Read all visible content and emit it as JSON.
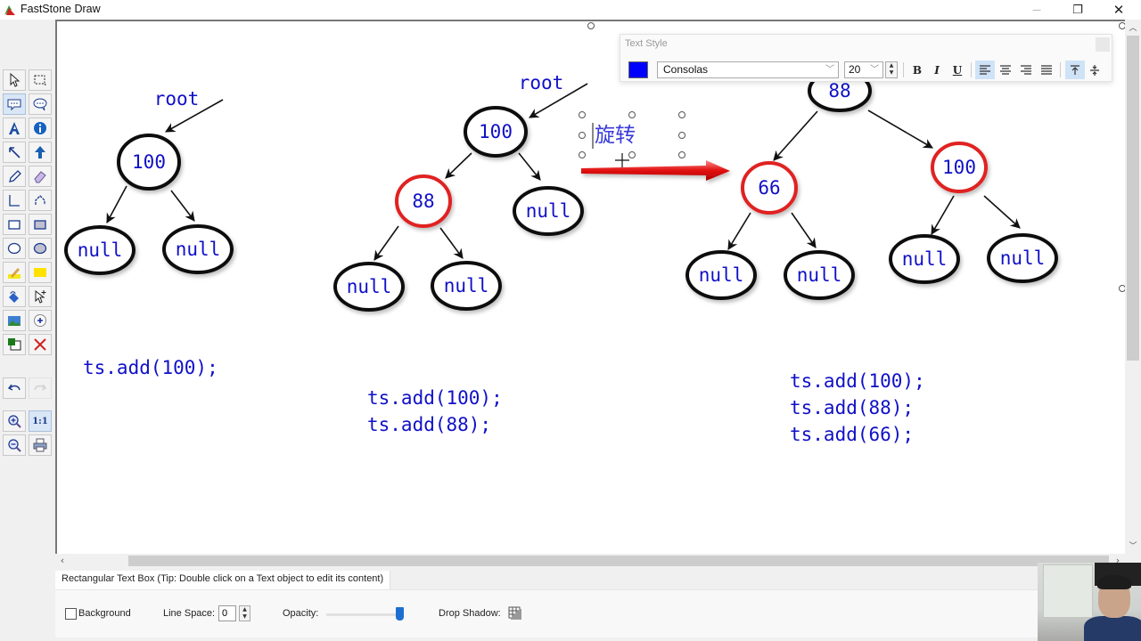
{
  "window": {
    "title": "FastStone Draw",
    "controls": {
      "minimize": "—",
      "maximize": "❐",
      "close": "✕"
    }
  },
  "toolbox": {
    "tools": [
      {
        "name": "select-tool",
        "icon": "cursor-arrow-icon"
      },
      {
        "name": "region-select-tool",
        "icon": "dashed-rect-icon"
      },
      {
        "name": "rect-callout-tool",
        "icon": "rect-callout-icon",
        "active": true
      },
      {
        "name": "round-callout-tool",
        "icon": "round-callout-icon"
      },
      {
        "name": "text-tool",
        "icon": "text-a-icon"
      },
      {
        "name": "info-tool",
        "icon": "info-icon"
      },
      {
        "name": "arrow-tool",
        "icon": "arrow-icon"
      },
      {
        "name": "thick-arrow-tool",
        "icon": "up-arrow-icon"
      },
      {
        "name": "pencil-tool",
        "icon": "pencil-icon"
      },
      {
        "name": "eraser-tool",
        "icon": "eraser-icon"
      },
      {
        "name": "line-tool",
        "icon": "polyline-icon"
      },
      {
        "name": "curve-tool",
        "icon": "curve-icon"
      },
      {
        "name": "rectangle-tool",
        "icon": "rectangle-icon"
      },
      {
        "name": "filled-rectangle-tool",
        "icon": "filled-rectangle-icon"
      },
      {
        "name": "ellipse-tool",
        "icon": "ellipse-icon"
      },
      {
        "name": "filled-ellipse-tool",
        "icon": "filled-ellipse-icon"
      },
      {
        "name": "highlighter-tool",
        "icon": "highlighter-icon"
      },
      {
        "name": "highlight-rect-tool",
        "icon": "yellow-rect-icon"
      },
      {
        "name": "fill-tool",
        "icon": "paint-bucket-icon"
      },
      {
        "name": "add-cursor-tool",
        "icon": "cursor-plus-icon"
      },
      {
        "name": "insert-image-tool",
        "icon": "image-icon"
      },
      {
        "name": "step-number-tool",
        "icon": "circle-plus-icon"
      },
      {
        "name": "color-swap-tool",
        "icon": "color-swap-icon"
      },
      {
        "name": "delete-tool",
        "icon": "red-x-icon"
      }
    ],
    "undo_icon": "undo-icon",
    "redo_icon": "redo-icon",
    "zoom_in_icon": "zoom-in-icon",
    "actual_size_label": "1:1",
    "zoom_out_icon": "zoom-out-icon",
    "print_icon": "print-icon"
  },
  "text_style_panel": {
    "title": "Text Style",
    "color": "#0000ff",
    "font": "Consolas",
    "size": "20",
    "bold_label": "B",
    "italic_label": "I",
    "underline_label": "U",
    "align_left_active": true,
    "valign_top_active": true
  },
  "canvas": {
    "node_text_color": "#1010c8",
    "highlight_color": "#e02020",
    "diagrams": [
      {
        "root_label": "root",
        "nodes": [
          {
            "id": "a",
            "label": "100",
            "highlight": false
          },
          {
            "id": "b",
            "label": "null",
            "highlight": false
          },
          {
            "id": "c",
            "label": "null",
            "highlight": false
          }
        ],
        "code": [
          "ts.add(100);"
        ]
      },
      {
        "root_label": "root",
        "nodes": [
          {
            "id": "a",
            "label": "100",
            "highlight": false
          },
          {
            "id": "b",
            "label": "88",
            "highlight": true
          },
          {
            "id": "c",
            "label": "null",
            "highlight": false
          },
          {
            "id": "d",
            "label": "null",
            "highlight": false
          },
          {
            "id": "e",
            "label": "null",
            "highlight": false
          }
        ],
        "code": [
          "ts.add(100);",
          "ts.add(88);"
        ]
      },
      {
        "root_label": "",
        "nodes": [
          {
            "id": "a",
            "label": "88",
            "highlight": false
          },
          {
            "id": "b",
            "label": "66",
            "highlight": true
          },
          {
            "id": "c",
            "label": "100",
            "highlight": true
          },
          {
            "id": "d",
            "label": "null",
            "highlight": false
          },
          {
            "id": "e",
            "label": "null",
            "highlight": false
          },
          {
            "id": "f",
            "label": "null",
            "highlight": false
          },
          {
            "id": "g",
            "label": "null",
            "highlight": false
          }
        ],
        "code": [
          "ts.add(100);",
          "ts.add(88);",
          "ts.add(66);"
        ]
      }
    ],
    "editing_text": "旋转"
  },
  "status": {
    "tip": "Rectangular Text Box (Tip: Double click on a Text object to edit its content)"
  },
  "properties": {
    "background_label": "Background",
    "background_checked": false,
    "line_space_label": "Line Space:",
    "line_space_value": "0",
    "opacity_label": "Opacity:",
    "opacity_value": 1.0,
    "drop_shadow_label": "Drop Shadow:"
  }
}
